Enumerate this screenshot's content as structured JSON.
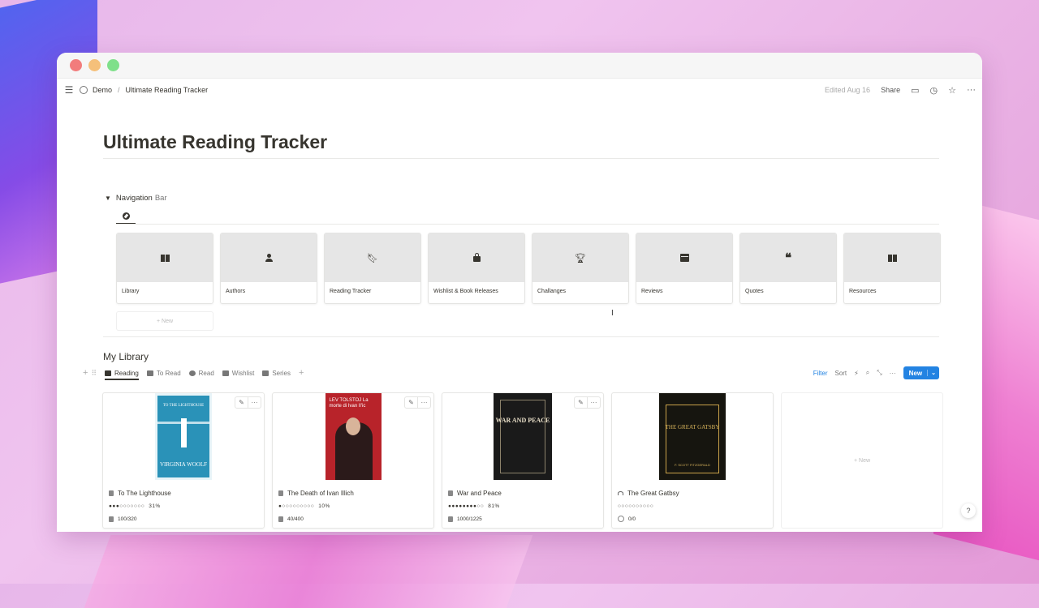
{
  "breadcrumb": {
    "workspace": "Demo",
    "separator": "/",
    "page": "Ultimate Reading Tracker"
  },
  "topbar": {
    "edited": "Edited Aug 16",
    "share": "Share"
  },
  "page_title": "Ultimate Reading Tracker",
  "toggle": {
    "label_1": "Navigation",
    "label_2": "Bar"
  },
  "nav_cards": [
    {
      "label": "Library",
      "icon": "book-open-icon"
    },
    {
      "label": "Authors",
      "icon": "person-icon"
    },
    {
      "label": "Reading Tracker",
      "icon": "bookmark-icon"
    },
    {
      "label": "Wishlist & Book Releases",
      "icon": "shopping-bag-icon"
    },
    {
      "label": "Challanges",
      "icon": "trophy-icon"
    },
    {
      "label": "Reviews",
      "icon": "calendar-icon"
    },
    {
      "label": "Quotes",
      "icon": "quote-icon"
    },
    {
      "label": "Resources",
      "icon": "open-book-icon"
    }
  ],
  "new_label": "New",
  "library": {
    "title": "My Library",
    "tabs": [
      "Reading",
      "To Read",
      "Read",
      "Wishlist",
      "Series"
    ],
    "filter": "Filter",
    "sort": "Sort",
    "new_button": "New",
    "books": [
      {
        "title": "To The Lighthouse",
        "progress_dots": "●●●○○○○○○○",
        "percent": "31%",
        "pages": "100/320",
        "format_icon": "book-icon",
        "cover_title": "TO THE LIGHTHOUSE",
        "cover_author": "VIRGINIA WOOLF",
        "cover_color": "#2a92b8"
      },
      {
        "title": "The Death of Ivan Illich",
        "progress_dots": "●○○○○○○○○○",
        "percent": "10%",
        "pages": "40/400",
        "format_icon": "book-icon",
        "cover_title": "LEV TOLSTOJ La morte di Ivan Il'ic",
        "cover_color": "#b8232a"
      },
      {
        "title": "War and Peace",
        "progress_dots": "●●●●●●●●○○",
        "percent": "81%",
        "pages": "1000/1225",
        "format_icon": "book-icon",
        "cover_title": "WAR AND PEACE",
        "cover_color": "#1a1a1a"
      },
      {
        "title": "The Great Gatbsy",
        "progress_dots": "○○○○○○○○○○",
        "percent": "",
        "pages": "0/0",
        "format_icon": "headphones-icon",
        "cover_title": "THE GREAT GATSBY",
        "cover_author": "F. SCOTT FITZGERALD",
        "cover_color": "#16150f"
      }
    ]
  },
  "help": "?"
}
